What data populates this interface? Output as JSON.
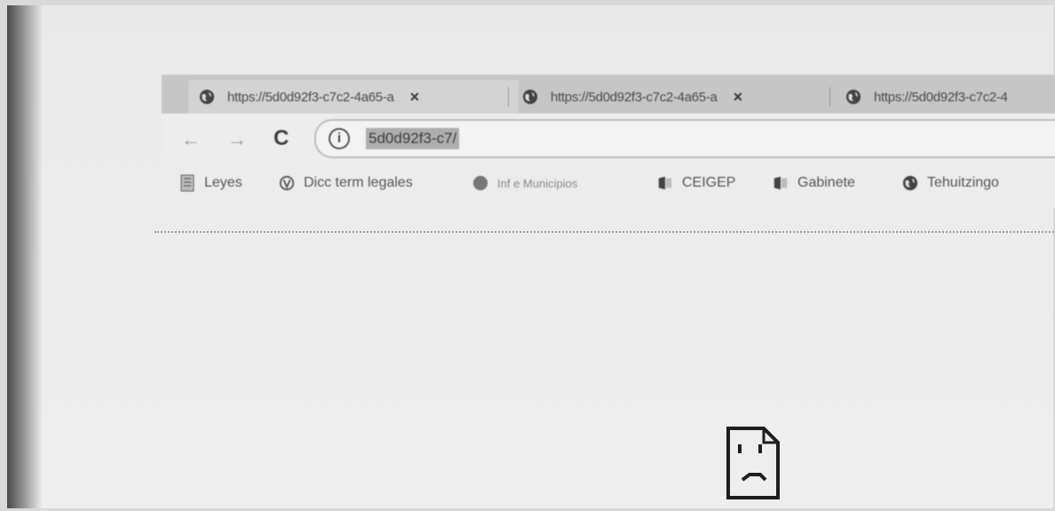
{
  "tabs": [
    {
      "title": "https://5d0d92f3-c7c2-4a65-a",
      "active": true,
      "close": "×",
      "icon": "globe-icon"
    },
    {
      "title": "https://5d0d92f3-c7c2-4a65-a",
      "active": false,
      "close": "×",
      "icon": "globe-icon"
    },
    {
      "title": "https://5d0d92f3-c7c2-4",
      "active": false,
      "icon": "globe-icon"
    }
  ],
  "toolbar": {
    "back": "←",
    "forward": "→",
    "reload": "C",
    "info": "i",
    "url": "5d0d92f3-c7/"
  },
  "bookmarks": [
    {
      "label": "Leyes",
      "icon": "document-icon"
    },
    {
      "label": "Dicc term legales",
      "icon": "logo-icon"
    },
    {
      "label": "Inf e Municipios",
      "icon": "circle-icon"
    },
    {
      "label": "CEIGEP",
      "icon": "bookmark-app-icon"
    },
    {
      "label": "Gabinete",
      "icon": "bookmark-app-icon"
    },
    {
      "label": "Tehuitzingo",
      "icon": "globe-icon"
    }
  ],
  "error_page": {
    "icon": "sad-file-icon"
  }
}
